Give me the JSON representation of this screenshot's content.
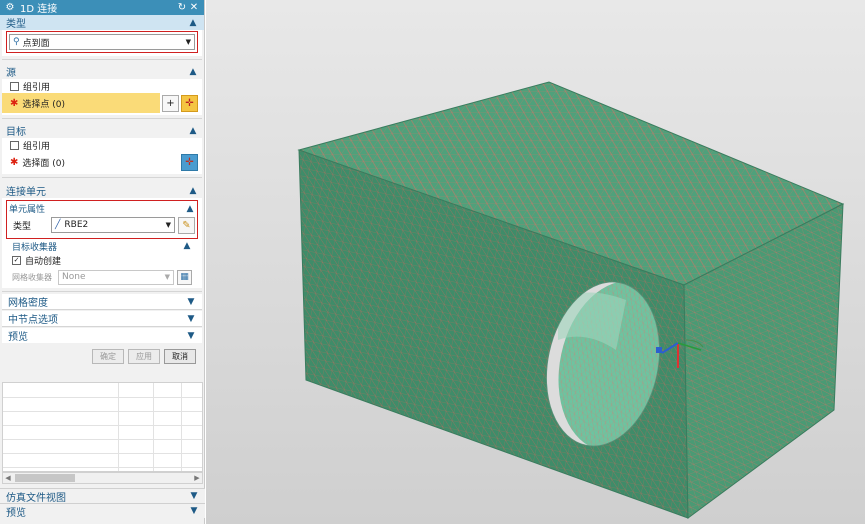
{
  "window": {
    "title": "1D 连接"
  },
  "sections": {
    "type": {
      "label": "类型",
      "value": "点到面"
    },
    "source": {
      "label": "源",
      "group_ref": "组引用",
      "select_points": "选择点 (0)"
    },
    "target": {
      "label": "目标",
      "group_ref": "组引用",
      "select_faces": "选择面 (0)"
    },
    "connection": {
      "label": "连接单元",
      "element_props": {
        "label": "单元属性",
        "type_label": "类型",
        "type_value": "RBE2"
      },
      "collector": {
        "label": "目标收集器",
        "auto_create": "自动创建",
        "mesh_collector_label": "网格收集器",
        "mesh_collector_value": "None"
      }
    },
    "mesh_density": {
      "label": "网格密度"
    },
    "mid_node": {
      "label": "中节点选项"
    },
    "preview": {
      "label": "预览"
    }
  },
  "buttons": {
    "ok": "确定",
    "apply": "应用",
    "cancel": "取消"
  },
  "bottom": {
    "sim_file_view": "仿真文件视图",
    "preview": "预览"
  },
  "colors": {
    "mesh_face": "#4c9d78",
    "mesh_edge": "#c87565",
    "titlebar": "#3c8fb8"
  }
}
